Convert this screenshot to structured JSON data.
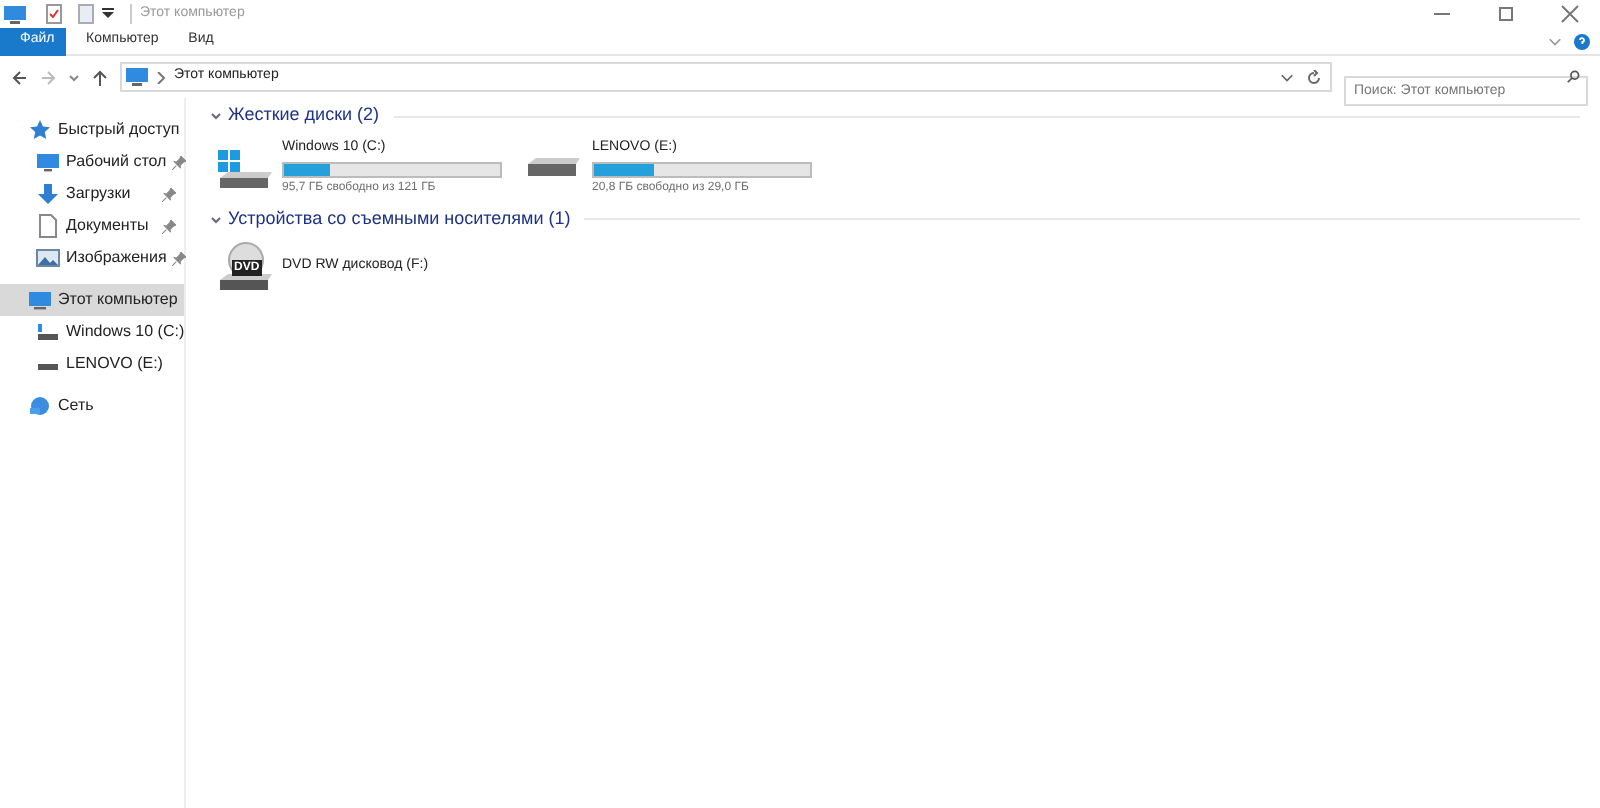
{
  "window": {
    "title": "Этот компьютер"
  },
  "tabs": [
    {
      "label": "Файл",
      "selected": true
    },
    {
      "label": "Компьютер",
      "selected": false
    },
    {
      "label": "Вид",
      "selected": false
    }
  ],
  "address": {
    "path": "Этот компьютер"
  },
  "search": {
    "placeholder": "Поиск: Этот компьютер"
  },
  "sidebar": {
    "items": [
      {
        "label": "Быстрый доступ",
        "kind": "star",
        "selected": false,
        "children": [
          {
            "label": "Рабочий стол",
            "kind": "desktop",
            "pinned": true,
            "selected": false
          },
          {
            "label": "Загрузки",
            "kind": "download",
            "pinned": true,
            "selected": false
          },
          {
            "label": "Документы",
            "kind": "document",
            "pinned": true,
            "selected": false
          },
          {
            "label": "Изображения",
            "kind": "image",
            "pinned": true,
            "selected": false
          }
        ]
      },
      {
        "label": "Этот компьютер",
        "kind": "computer",
        "selected": true,
        "children": [
          {
            "label": "Windows 10 (C:)",
            "kind": "windrive",
            "pinned": false,
            "selected": false
          },
          {
            "label": "LENOVO (E:)",
            "kind": "drive",
            "pinned": false,
            "selected": false
          }
        ]
      },
      {
        "label": "Сеть",
        "kind": "network",
        "selected": false
      }
    ]
  },
  "groups": [
    {
      "title": "Жесткие диски (2)",
      "items": [
        {
          "name": "Windows 10 (C:)",
          "kind": "windrive",
          "level": 0.21,
          "info": "95,7 ГБ свободно из 121 ГБ"
        },
        {
          "name": "LENOVO (E:)",
          "kind": "drive",
          "level": 0.28,
          "info": "20,8 ГБ свободно из 29,0 ГБ"
        }
      ]
    },
    {
      "title": "Устройства со съемными носителями (1)",
      "items": [
        {
          "name": "DVD RW дисковод (F:)",
          "kind": "dvd",
          "icon_label": "DVD"
        }
      ]
    }
  ]
}
